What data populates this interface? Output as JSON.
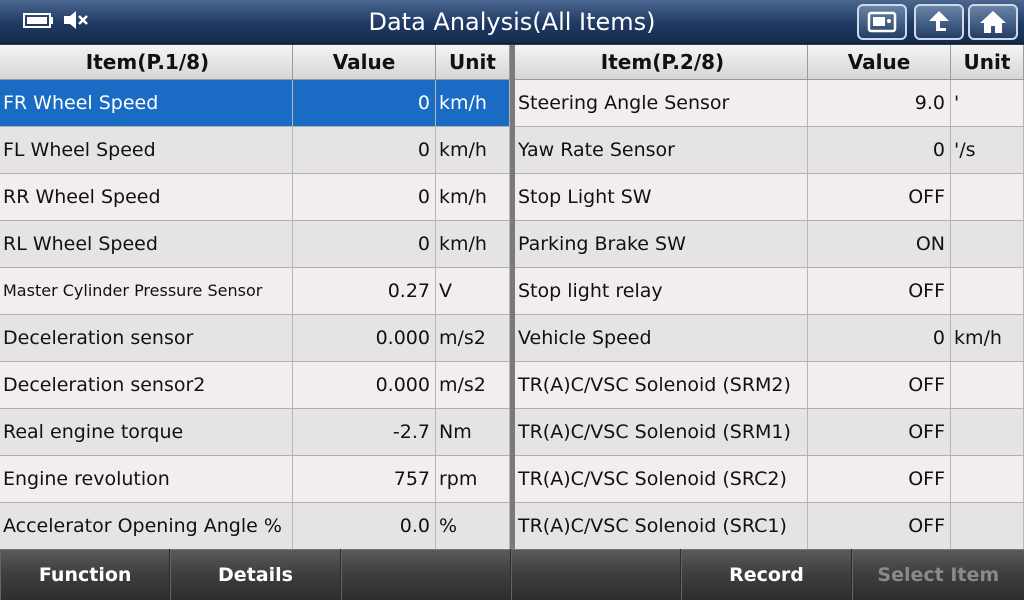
{
  "header": {
    "title": "Data Analysis(All Items)",
    "icons": [
      "battery-icon",
      "mute-icon"
    ],
    "buttons": [
      "screenshot-icon",
      "back-icon",
      "home-icon"
    ]
  },
  "left_table": {
    "headers": {
      "item": "Item(P.1/8)",
      "value": "Value",
      "unit": "Unit"
    },
    "rows": [
      {
        "item": "FR Wheel Speed",
        "value": "0",
        "unit": "km/h"
      },
      {
        "item": "FL Wheel Speed",
        "value": "0",
        "unit": "km/h"
      },
      {
        "item": "RR Wheel Speed",
        "value": "0",
        "unit": "km/h"
      },
      {
        "item": "RL Wheel Speed",
        "value": "0",
        "unit": "km/h"
      },
      {
        "item": "Master Cylinder Pressure Sensor",
        "value": "0.27",
        "unit": "V"
      },
      {
        "item": "Deceleration sensor",
        "value": "0.000",
        "unit": "m/s2"
      },
      {
        "item": "Deceleration sensor2",
        "value": "0.000",
        "unit": "m/s2"
      },
      {
        "item": "Real engine torque",
        "value": "-2.7",
        "unit": "Nm"
      },
      {
        "item": "Engine revolution",
        "value": "757",
        "unit": "rpm"
      },
      {
        "item": "Accelerator Opening Angle %",
        "value": "0.0",
        "unit": "%"
      }
    ]
  },
  "right_table": {
    "headers": {
      "item": "Item(P.2/8)",
      "value": "Value",
      "unit": "Unit"
    },
    "rows": [
      {
        "item": "Steering Angle Sensor",
        "value": "9.0",
        "unit": "'"
      },
      {
        "item": "Yaw Rate Sensor",
        "value": "0",
        "unit": "'/s"
      },
      {
        "item": "Stop Light SW",
        "value": "OFF",
        "unit": ""
      },
      {
        "item": "Parking Brake SW",
        "value": "ON",
        "unit": ""
      },
      {
        "item": "Stop light relay",
        "value": "OFF",
        "unit": ""
      },
      {
        "item": "Vehicle Speed",
        "value": "0",
        "unit": "km/h"
      },
      {
        "item": "TR(A)C/VSC Solenoid (SRM2)",
        "value": "OFF",
        "unit": ""
      },
      {
        "item": "TR(A)C/VSC Solenoid (SRM1)",
        "value": "OFF",
        "unit": ""
      },
      {
        "item": "TR(A)C/VSC Solenoid (SRC2)",
        "value": "OFF",
        "unit": ""
      },
      {
        "item": "TR(A)C/VSC Solenoid (SRC1)",
        "value": "OFF",
        "unit": ""
      }
    ]
  },
  "footer": {
    "buttons": [
      "Function",
      "Details",
      "",
      "",
      "Record",
      "Select Item"
    ]
  },
  "colors": {
    "selected_row": "#1a6bc4",
    "header_bar": "#1f3a63"
  }
}
